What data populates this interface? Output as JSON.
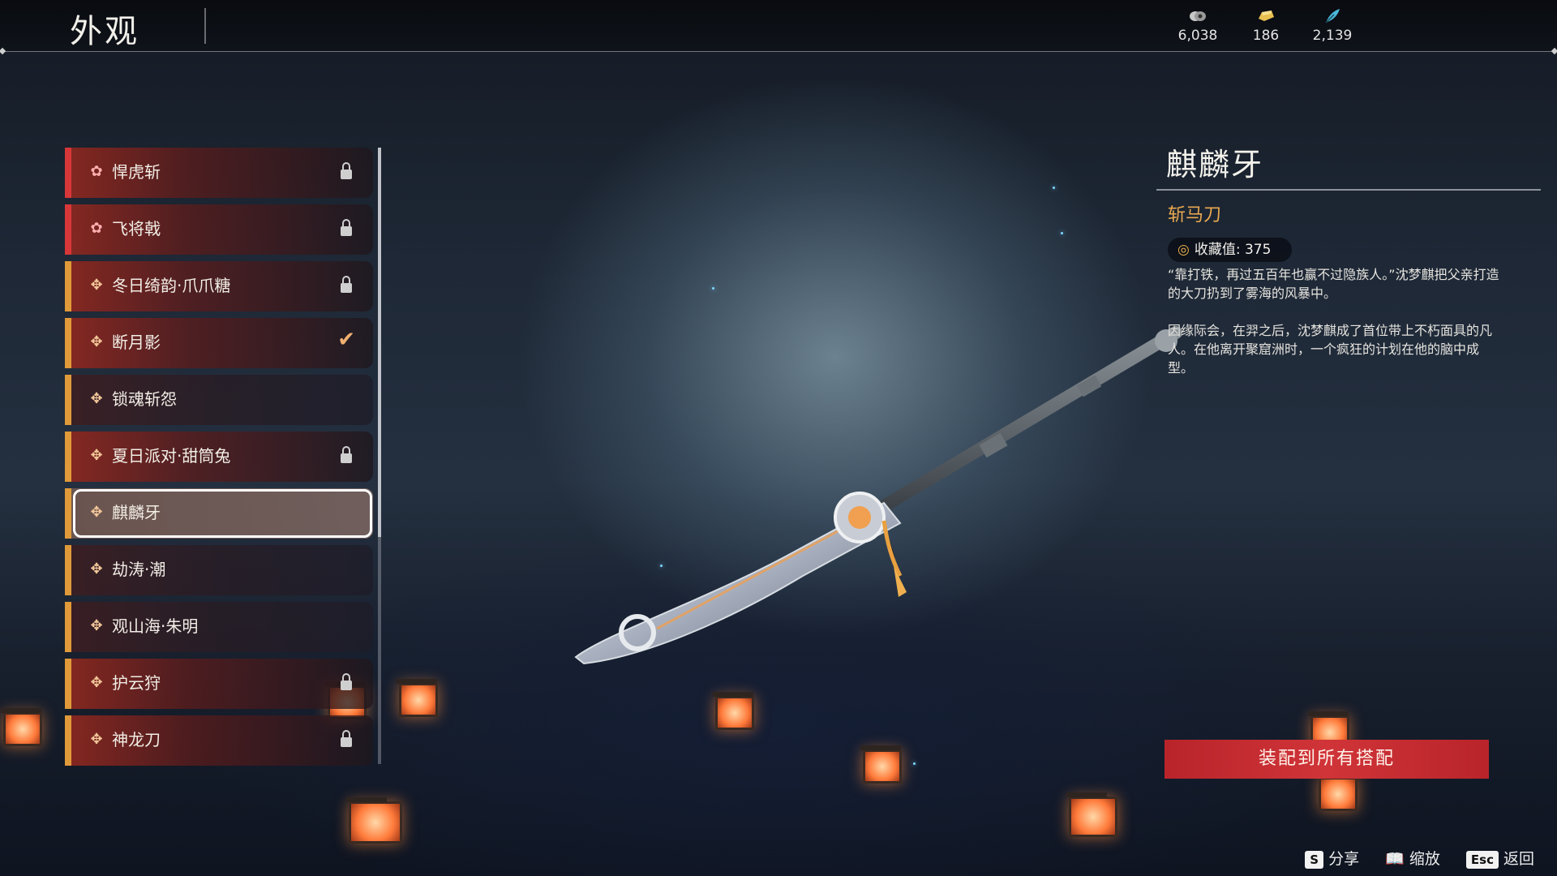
{
  "header": {
    "title": "外观",
    "currencies": [
      {
        "icon": "coins-icon",
        "value": "6,038"
      },
      {
        "icon": "gold-ingot-icon",
        "value": "186"
      },
      {
        "icon": "feather-icon",
        "value": "2,139"
      }
    ]
  },
  "list": {
    "items": [
      {
        "name": "悍虎斩",
        "state": "locked",
        "tier": "red"
      },
      {
        "name": "飞将戟",
        "state": "locked",
        "tier": "red"
      },
      {
        "name": "冬日绮韵·爪爪糖",
        "state": "locked",
        "tier": "gold"
      },
      {
        "name": "断月影",
        "state": "equipped",
        "tier": "gold"
      },
      {
        "name": "锁魂斩怨",
        "state": "owned",
        "tier": "gold"
      },
      {
        "name": "夏日派对·甜筒兔",
        "state": "locked",
        "tier": "gold"
      },
      {
        "name": "麒麟牙",
        "state": "selected",
        "tier": "gold"
      },
      {
        "name": "劫涛·潮",
        "state": "owned",
        "tier": "gold"
      },
      {
        "name": "观山海·朱明",
        "state": "owned",
        "tier": "gold"
      },
      {
        "name": "护云狩",
        "state": "locked",
        "tier": "gold"
      },
      {
        "name": "神龙刀",
        "state": "locked",
        "tier": "gold"
      }
    ]
  },
  "detail": {
    "name": "麒麟牙",
    "type": "斩马刀",
    "collection_label": "收藏值: 375",
    "description": [
      "“靠打铁，再过五百年也赢不过隐族人。”沈梦麒把父亲打造的大刀扔到了雾海的风暴中。",
      "因缘际会，在羿之后，沈梦麒成了首位带上不朽面具的凡人。在他离开聚窟洲时，一个疯狂的计划在他的脑中成型。"
    ]
  },
  "actions": {
    "equip_all": "装配到所有搭配"
  },
  "hints": {
    "share_key": "S",
    "share_label": "分享",
    "zoom_label": "缩放",
    "back_key": "Esc",
    "back_label": "返回"
  },
  "colors": {
    "accent_red": "#d03438",
    "accent_gold": "#e8a850",
    "tier_red": "#d8373a",
    "tier_gold": "#e09a3a"
  }
}
